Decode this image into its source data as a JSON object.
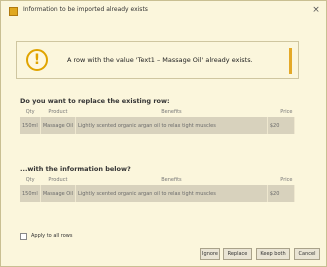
{
  "dialog": {
    "title": "Information to be imported already exists",
    "close_symbol": "×",
    "message": "A row with the value 'Text1 – Massage Oil' already exists."
  },
  "existing": {
    "heading": "Do you want to replace the existing row:",
    "columns": [
      "Qty",
      "Product",
      "Benefits",
      "Price"
    ],
    "row": [
      "150ml",
      "Massage Oil",
      "Lightly scented organic argan oil to relax tight muscles",
      "$20"
    ]
  },
  "incoming": {
    "heading": "...with the information below?",
    "columns": [
      "Qty",
      "Product",
      "Benefits",
      "Price"
    ],
    "row": [
      "150ml",
      "Massage Oil",
      "Lightly scented organic argan oil to relax tight muscles",
      "$20"
    ]
  },
  "apply_all": {
    "label": "Apply to all rows",
    "checked": false
  },
  "buttons": {
    "ignore": "Ignore",
    "replace": "Replace",
    "keep_both": "Keep both",
    "cancel": "Cancel"
  },
  "colors": {
    "background": "#fbf6dc",
    "warning": "#e0a400",
    "table_cell": "#d8d2bd"
  },
  "icons": {
    "app": "app-icon",
    "warning": "warning-icon",
    "close": "close-icon"
  }
}
